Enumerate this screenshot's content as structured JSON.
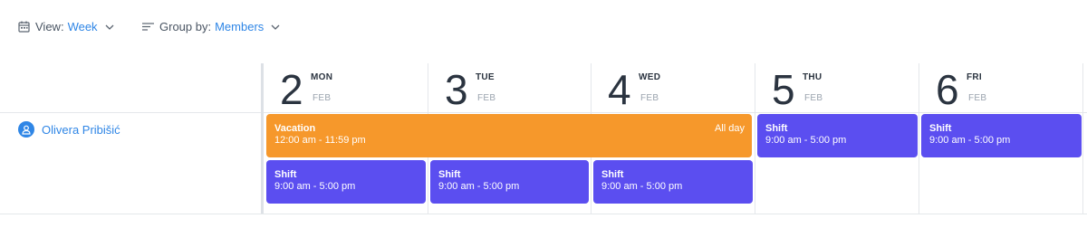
{
  "toolbar": {
    "view_label": "View:",
    "view_value": "Week",
    "group_label": "Group by:",
    "group_value": "Members",
    "accent_color": "#2f86e6"
  },
  "days": [
    {
      "num": "2",
      "dow": "MON",
      "month": "FEB"
    },
    {
      "num": "3",
      "dow": "TUE",
      "month": "FEB"
    },
    {
      "num": "4",
      "dow": "WED",
      "month": "FEB"
    },
    {
      "num": "5",
      "dow": "THU",
      "month": "FEB"
    },
    {
      "num": "6",
      "dow": "FRI",
      "month": "FEB"
    }
  ],
  "member": {
    "name": "Olivera Pribišić",
    "icon": "user-icon"
  },
  "events": {
    "vacation": {
      "title": "Vacation",
      "time": "12:00 am - 11:59 pm",
      "badge": "All day",
      "color": "#f6982b"
    },
    "shift_mon": {
      "title": "Shift",
      "time": "9:00 am - 5:00 pm",
      "color": "#5b4ef0"
    },
    "shift_tue": {
      "title": "Shift",
      "time": "9:00 am - 5:00 pm",
      "color": "#5b4ef0"
    },
    "shift_wed": {
      "title": "Shift",
      "time": "9:00 am - 5:00 pm",
      "color": "#5b4ef0"
    },
    "shift_thu": {
      "title": "Shift",
      "time": "9:00 am - 5:00 pm",
      "color": "#5b4ef0"
    },
    "shift_fri": {
      "title": "Shift",
      "time": "9:00 am - 5:00 pm",
      "color": "#5b4ef0"
    }
  }
}
